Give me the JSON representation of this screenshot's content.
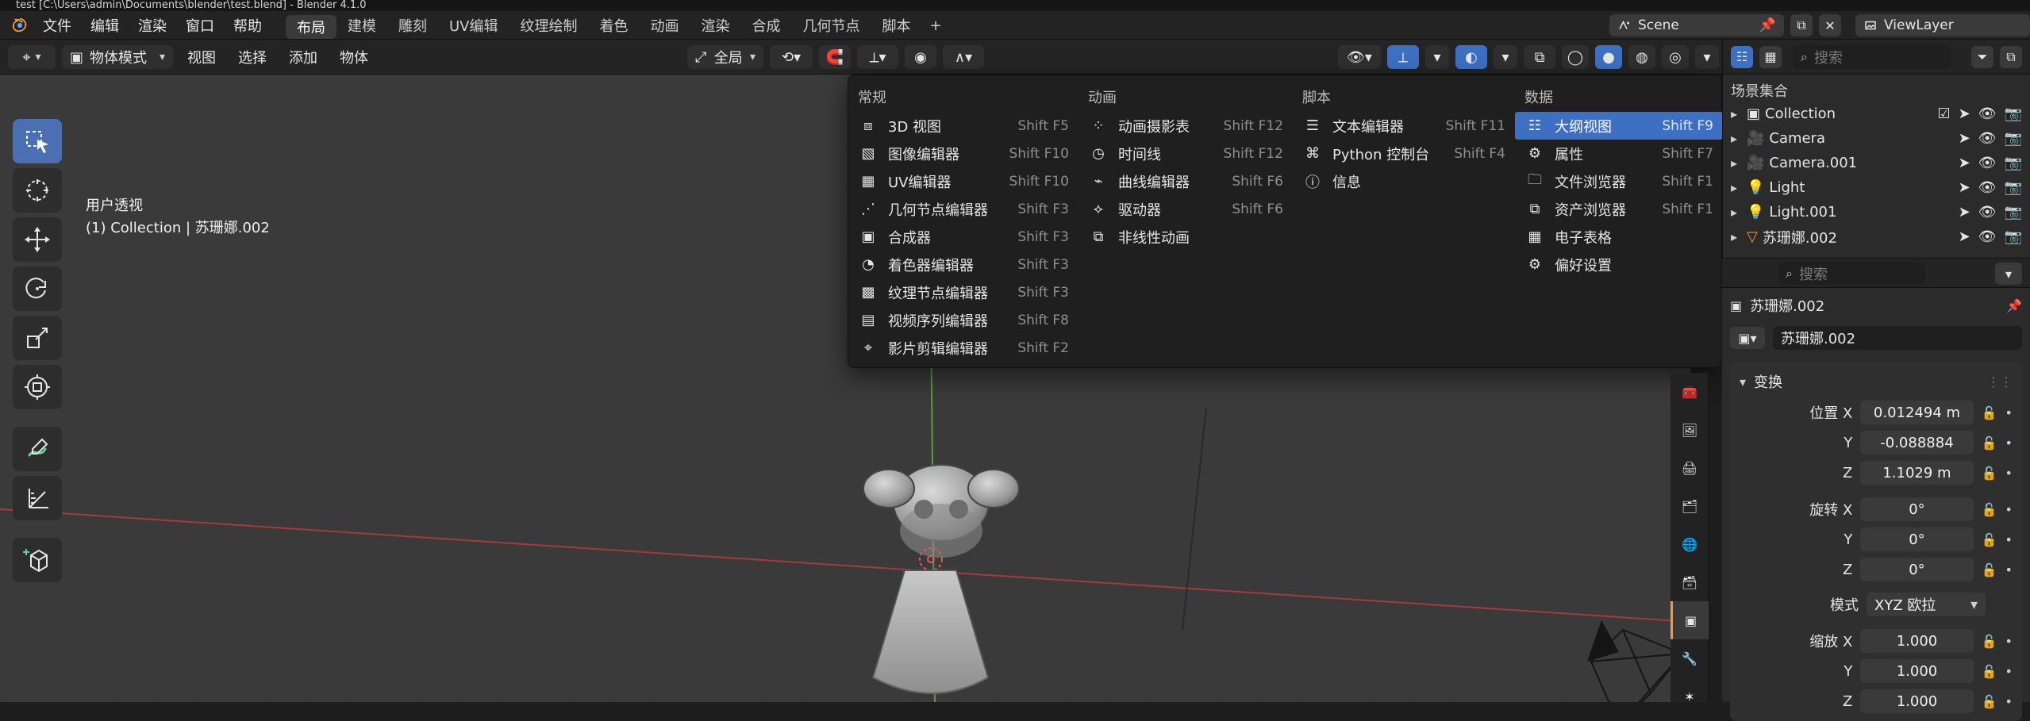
{
  "window": {
    "title": "test [C:\\Users\\admin\\Documents\\blender\\test.blend] - Blender 4.1.0"
  },
  "menubar": {
    "items": [
      "文件",
      "编辑",
      "渲染",
      "窗口",
      "帮助"
    ],
    "workspaces": [
      "布局",
      "建模",
      "雕刻",
      "UV编辑",
      "纹理绘制",
      "着色",
      "动画",
      "渲染",
      "合成",
      "几何节点",
      "脚本"
    ],
    "add_workspace": "+",
    "scene_label": "Scene",
    "viewlayer_label": "ViewLayer"
  },
  "header3d": {
    "mode": "物体模式",
    "menus": [
      "视图",
      "选择",
      "添加",
      "物体"
    ],
    "transform_orientation": "全局"
  },
  "viewport": {
    "info_line1": "用户透视",
    "info_line2": "(1) Collection | 苏珊娜.002"
  },
  "editor_menu": {
    "columns": [
      {
        "title": "常规",
        "items": [
          {
            "label": "3D 视图",
            "shortcut": "Shift F5",
            "icon": "3d-view-icon"
          },
          {
            "label": "图像编辑器",
            "shortcut": "Shift F10",
            "icon": "image-editor-icon"
          },
          {
            "label": "UV编辑器",
            "shortcut": "Shift F10",
            "icon": "uv-editor-icon"
          },
          {
            "label": "几何节点编辑器",
            "shortcut": "Shift F3",
            "icon": "geometry-nodes-icon"
          },
          {
            "label": "合成器",
            "shortcut": "Shift F3",
            "icon": "compositor-icon"
          },
          {
            "label": "着色器编辑器",
            "shortcut": "Shift F3",
            "icon": "shader-editor-icon"
          },
          {
            "label": "纹理节点编辑器",
            "shortcut": "Shift F3",
            "icon": "texture-nodes-icon"
          },
          {
            "label": "视频序列编辑器",
            "shortcut": "Shift F8",
            "icon": "sequencer-icon"
          },
          {
            "label": "影片剪辑编辑器",
            "shortcut": "Shift F2",
            "icon": "movie-clip-icon"
          }
        ]
      },
      {
        "title": "动画",
        "items": [
          {
            "label": "动画摄影表",
            "shortcut": "Shift F12",
            "icon": "dopesheet-icon"
          },
          {
            "label": "时间线",
            "shortcut": "Shift F12",
            "icon": "timeline-icon"
          },
          {
            "label": "曲线编辑器",
            "shortcut": "Shift F6",
            "icon": "graph-editor-icon"
          },
          {
            "label": "驱动器",
            "shortcut": "Shift F6",
            "icon": "drivers-icon"
          },
          {
            "label": "非线性动画",
            "shortcut": "",
            "icon": "nla-icon"
          }
        ]
      },
      {
        "title": "脚本",
        "items": [
          {
            "label": "文本编辑器",
            "shortcut": "Shift F11",
            "icon": "text-editor-icon"
          },
          {
            "label": "Python 控制台",
            "shortcut": "Shift F4",
            "icon": "python-console-icon"
          },
          {
            "label": "信息",
            "shortcut": "",
            "icon": "info-icon"
          }
        ]
      },
      {
        "title": "数据",
        "items": [
          {
            "label": "大纲视图",
            "shortcut": "Shift F9",
            "icon": "outliner-icon",
            "active": true
          },
          {
            "label": "属性",
            "shortcut": "Shift F7",
            "icon": "properties-icon"
          },
          {
            "label": "文件浏览器",
            "shortcut": "Shift F1",
            "icon": "file-browser-icon"
          },
          {
            "label": "资产浏览器",
            "shortcut": "Shift F1",
            "icon": "asset-browser-icon"
          },
          {
            "label": "电子表格",
            "shortcut": "",
            "icon": "spreadsheet-icon"
          },
          {
            "label": "偏好设置",
            "shortcut": "",
            "icon": "preferences-icon"
          }
        ]
      }
    ]
  },
  "outliner": {
    "search_placeholder": "搜索",
    "section_title": "场景集合",
    "items": [
      {
        "label": "Collection",
        "icon": "collection-icon"
      },
      {
        "label": "Camera",
        "icon": "camera-icon"
      },
      {
        "label": "Camera.001",
        "icon": "camera-icon"
      },
      {
        "label": "Light",
        "icon": "light-icon"
      },
      {
        "label": "Light.001",
        "icon": "light-icon"
      },
      {
        "label": "苏珊娜.002",
        "icon": "mesh-icon"
      }
    ]
  },
  "properties": {
    "search_placeholder": "搜索",
    "object_name": "苏珊娜.002",
    "object_datablock": "苏珊娜.002",
    "panel_transform": "变换",
    "location": {
      "label_x": "位置 X",
      "label_y": "Y",
      "label_z": "Z",
      "x": "0.012494 m",
      "y": "-0.088884",
      "z": "1.1029 m"
    },
    "rotation": {
      "label_x": "旋转 X",
      "label_y": "Y",
      "label_z": "Z",
      "x": "0°",
      "y": "0°",
      "z": "0°"
    },
    "mode": {
      "label": "模式",
      "value": "XYZ 欧拉"
    },
    "scale": {
      "label_x": "缩放 X",
      "label_y": "Y",
      "label_z": "Z",
      "x": "1.000",
      "y": "1.000",
      "z": "1.000"
    }
  },
  "colors": {
    "accent": "#3d6fc2",
    "active_tab": "#f29a3d",
    "camera": "#f29a3d",
    "light": "#62d39a"
  }
}
